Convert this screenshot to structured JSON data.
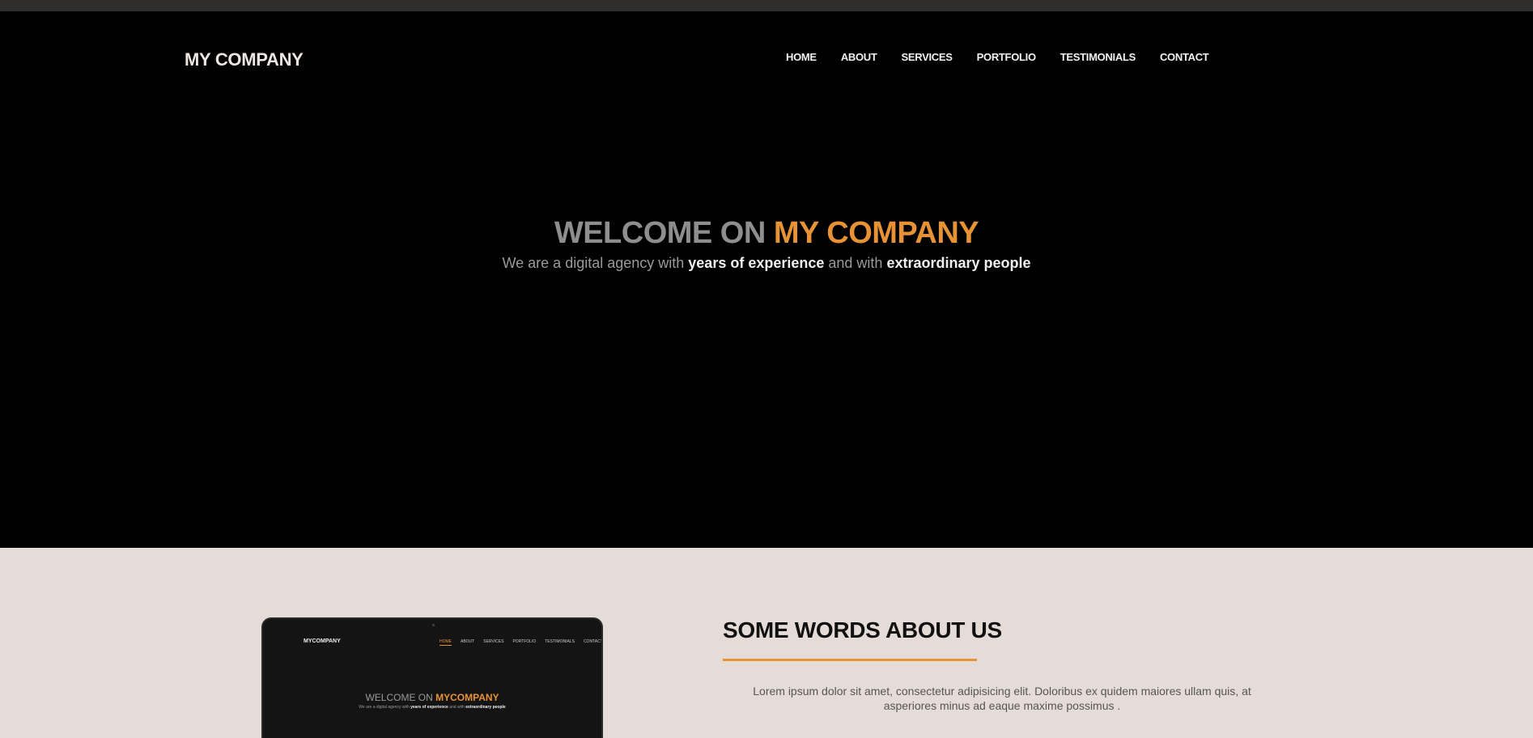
{
  "header": {
    "brand": "MY COMPANY",
    "nav": [
      "HOME",
      "ABOUT",
      "SERVICES",
      "PORTFOLIO",
      "TESTIMONIALS",
      "CONTACT"
    ]
  },
  "hero": {
    "title_prefix": "WELCOME ON ",
    "title_highlight": "MY COMPANY",
    "subtitle_part1": "We are a digital agency with ",
    "subtitle_bold1": "years of experience",
    "subtitle_part2": " and with ",
    "subtitle_bold2": "extraordinary people"
  },
  "about": {
    "title": "SOME WORDS ABOUT US",
    "text": "Lorem ipsum dolor sit amet, consectetur adipisicing elit. Doloribus ex quidem maiores ullam quis, at asperiores minus ad eaque maxime possimus .",
    "mockup": {
      "brand": "MYCOMPANY",
      "nav": [
        "HOME",
        "ABOUT",
        "SERVICES",
        "PORTFOLIO",
        "TESTIMONIALS",
        "CONTACT"
      ],
      "title_prefix": "WELCOME ON ",
      "title_highlight": "MYCOMPANY",
      "subtitle_part1": "We are a digital agency with ",
      "subtitle_bold1": "years of experience",
      "subtitle_part2": " and with ",
      "subtitle_bold2": "extraordinary people"
    }
  },
  "colors": {
    "accent": "#e79235",
    "hero_background": "#000000",
    "about_background": "#e6dcd7",
    "topbar": "#2f2e2d"
  }
}
